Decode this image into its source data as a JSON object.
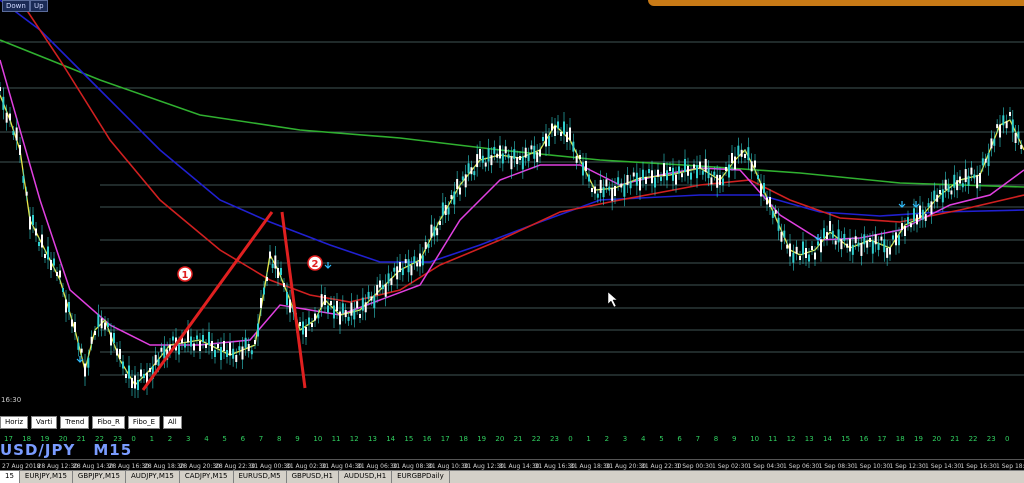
{
  "toolbar_top": {
    "down": "Down",
    "up": "Up"
  },
  "time_corner": "16:30",
  "markers": {
    "one": "1",
    "two": "2"
  },
  "tools": [
    "Horiz",
    "Varti",
    "Trend",
    "Fibo_R",
    "Fibo_E",
    "All"
  ],
  "symbol": {
    "pair": "USD/JPY",
    "tf": "M15"
  },
  "bar_numbers": [
    "17",
    "18",
    "19",
    "20",
    "21",
    "22",
    "23",
    "0",
    "1",
    "2",
    "3",
    "4",
    "5",
    "6",
    "7",
    "8",
    "9",
    "10",
    "11",
    "12",
    "13",
    "14",
    "15",
    "16",
    "17",
    "18",
    "19",
    "20",
    "21",
    "22",
    "23",
    "0",
    "1",
    "2",
    "3",
    "4",
    "5",
    "6",
    "7",
    "8",
    "9",
    "10",
    "11",
    "12",
    "13",
    "14",
    "15",
    "16",
    "17",
    "18",
    "19",
    "20",
    "21",
    "22",
    "23",
    "0"
  ],
  "time_labels": [
    "27 Aug 2018",
    "28 Aug 12:30",
    "28 Aug 14:30",
    "28 Aug 16:30",
    "28 Aug 18:30",
    "28 Aug 20:30",
    "28 Aug 22:30",
    "31 Aug 00:30",
    "31 Aug 02:30",
    "31 Aug 04:30",
    "31 Aug 06:30",
    "31 Aug 08:30",
    "31 Aug 10:30",
    "31 Aug 12:30",
    "31 Aug 14:30",
    "31 Aug 16:30",
    "31 Aug 18:30",
    "31 Aug 20:30",
    "31 Aug 22:30",
    "1 Sep 00:30",
    "1 Sep 02:30",
    "1 Sep 04:30",
    "1 Sep 06:30",
    "1 Sep 08:30",
    "1 Sep 10:30",
    "1 Sep 12:30",
    "1 Sep 14:30",
    "1 Sep 16:30",
    "1 Sep 18:30"
  ],
  "tabs": [
    "15",
    "EURJPY,M15",
    "GBPJPY,M15",
    "AUDJPY,M15",
    "CADJPY,M15",
    "EURUSD,M5",
    "GBPUSD,H1",
    "AUDUSD,H1",
    "EURGBPDaily"
  ],
  "colors": {
    "background": "#000000",
    "ema_fast": "#e8e84a",
    "ema_mid": "#e040e0",
    "ema_slow_red": "#d02020",
    "ema_blue": "#2020d0",
    "ema_green": "#30b030",
    "candle": "#30d0d0",
    "grid": "#7fa6a6",
    "drawing": "#e02020"
  }
}
